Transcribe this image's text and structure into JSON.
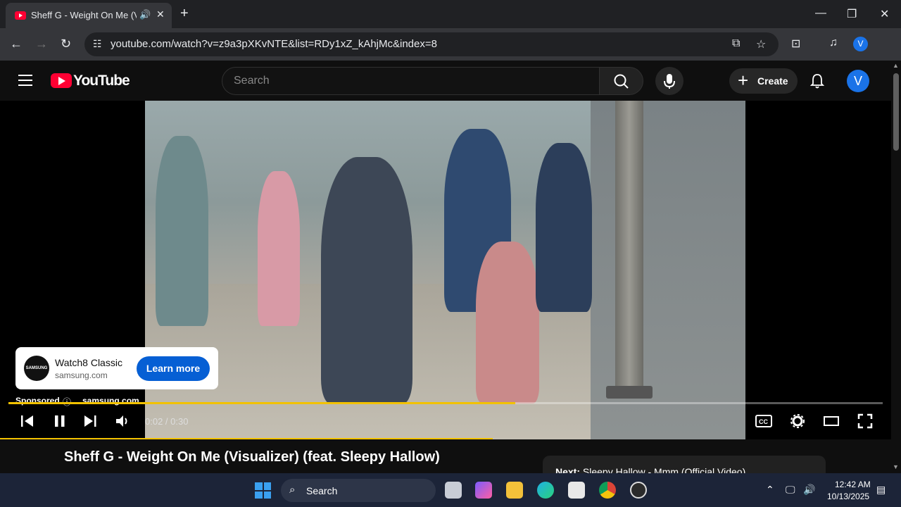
{
  "browser": {
    "tab_title": "Sheff G - Weight On Me (Vi",
    "tab_audio_icon": "speaker-icon",
    "new_tab_label": "+",
    "url": "youtube.com/watch?v=z9a3pXKvNTE&list=RDy1xZ_kAhjMc&index=8",
    "profile_initial": "V",
    "window_controls": [
      "—",
      "❐",
      "✕"
    ]
  },
  "youtube": {
    "wordmark": "YouTube",
    "search_placeholder": "Search",
    "create_label": "Create",
    "avatar_initial": "V"
  },
  "player": {
    "time_current": "0:02",
    "time_total": "0:30",
    "time_display": "0:02 / 0:30",
    "progress_fraction": 0.58,
    "ad": {
      "logo_text": "SAMSUNG",
      "title": "Watch8 Classic",
      "domain": "samsung.com",
      "cta": "Learn more",
      "sponsored_label": "Sponsored",
      "sponsored_domain": "samsung.com"
    }
  },
  "video": {
    "title": "Sheff G - Weight On Me (Visualizer) (feat. Sleepy Hallow)",
    "next_label": "Next:",
    "next_title": "Sleepy Hallow - Mmm (Official Video)"
  },
  "taskbar": {
    "search_label": "Search",
    "clock_time": "12:42 AM",
    "clock_date": "10/13/2025"
  },
  "colors": {
    "accent_progress": "#f2c200",
    "youtube_red": "#ff0033",
    "cta_blue": "#065fd4"
  }
}
